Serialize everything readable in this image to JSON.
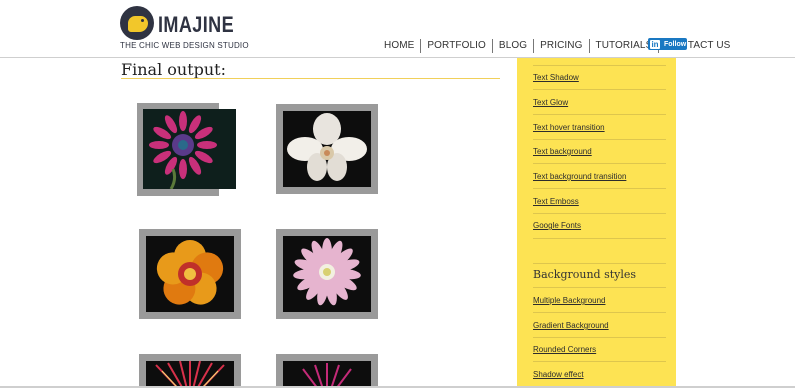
{
  "logo": {
    "name": "IMAJINE",
    "tagline": "THE CHIC WEB DESIGN STUDIO"
  },
  "nav": [
    "HOME",
    "PORTFOLIO",
    "BLOG",
    "PRICING",
    "TUTORIALS",
    "CONTACT US"
  ],
  "follow_button": {
    "icon": "in",
    "label": "Follow"
  },
  "main": {
    "title": "Final output:"
  },
  "sidebar": {
    "text_links": [
      "Text Shadow",
      "Text Glow",
      "Text hover transition",
      "Text background",
      "Text background transition",
      "Text Emboss",
      "Google Fonts"
    ],
    "section_heading": "Background styles",
    "background_links": [
      "Multiple Background",
      "Gradient Background",
      "Rounded Corners",
      "Shadow effect"
    ]
  },
  "colors": {
    "accent": "#fde353",
    "brand_dark": "#2f3342",
    "linkedin": "#1a78c2"
  }
}
